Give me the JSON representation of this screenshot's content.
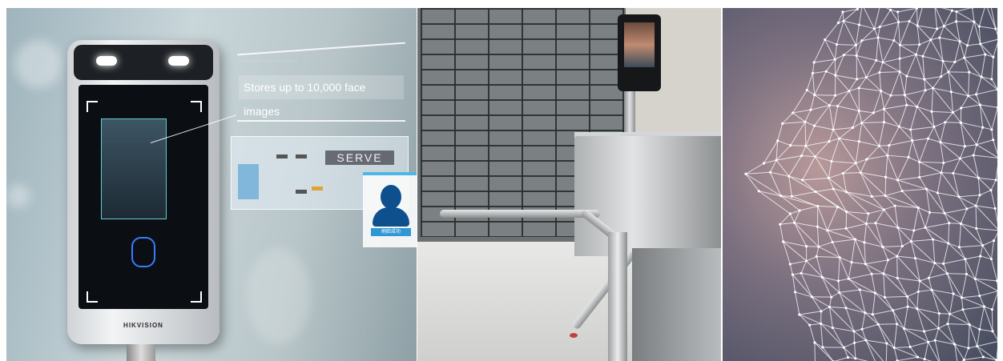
{
  "panels": [
    {
      "caption": "Stores up to 10,000 face images",
      "badge": "SERVE",
      "brand": "HIKVISION",
      "profile_tag": "刷脸成功"
    },
    {},
    {}
  ]
}
